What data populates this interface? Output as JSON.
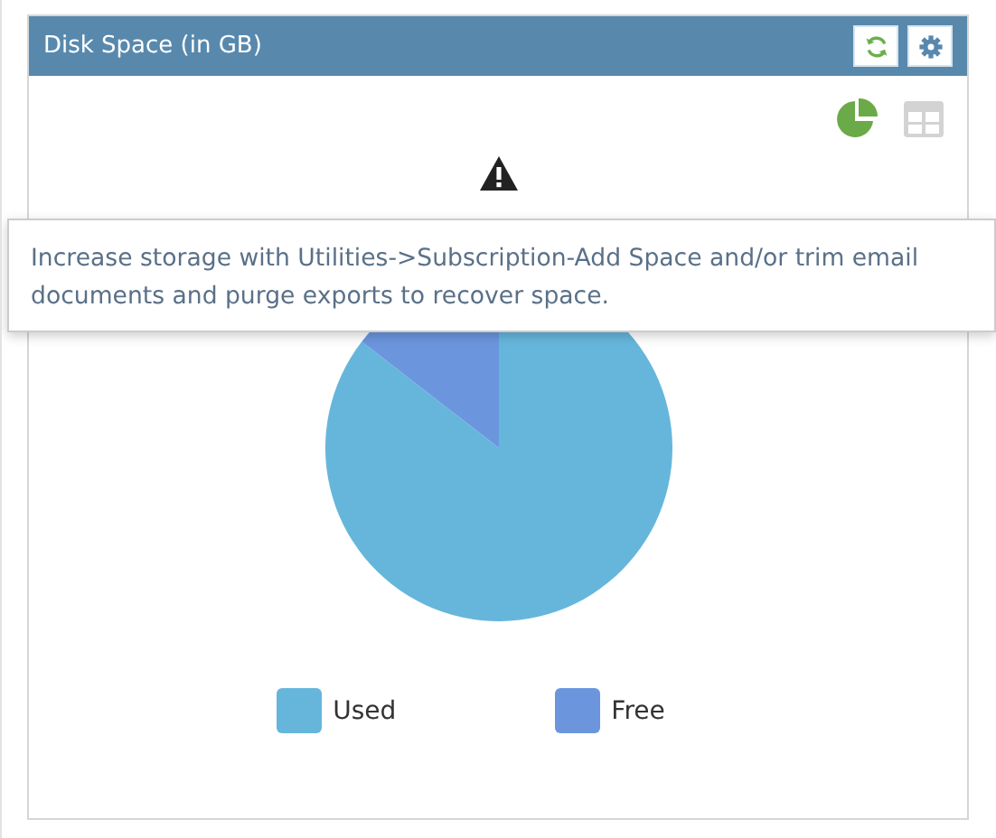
{
  "panel": {
    "title": "Disk Space (in GB)",
    "view_toggle": [
      {
        "kind": "pie",
        "selected": true
      },
      {
        "kind": "table",
        "selected": false
      }
    ]
  },
  "tooltip": {
    "text": "Increase storage with Utilities->Subscription-Add Space and/or trim email documents and purge exports to recover space."
  },
  "chart_data": {
    "type": "pie",
    "categories": [
      "Used",
      "Free"
    ],
    "values": [
      85.5,
      14.5
    ],
    "colors": [
      "#66b6dc",
      "#6b96de"
    ]
  }
}
